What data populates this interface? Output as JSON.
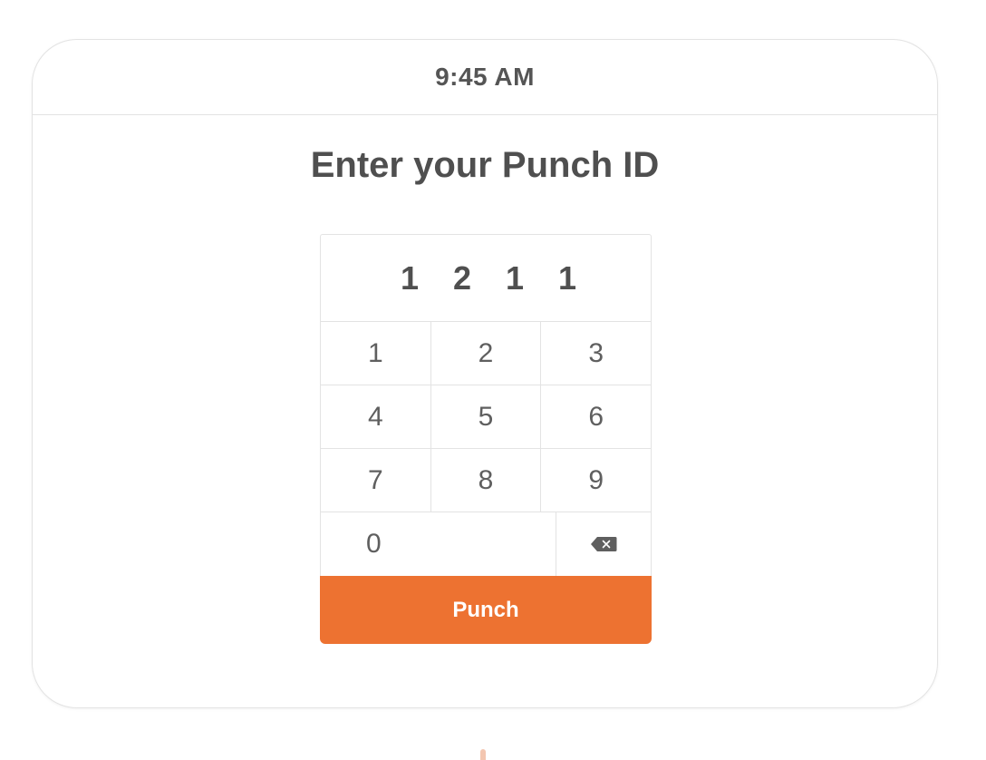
{
  "header": {
    "time": "9:45 AM"
  },
  "title": "Enter your Punch ID",
  "entered_digits": [
    "1",
    "2",
    "1",
    "1"
  ],
  "keypad": {
    "rows": [
      [
        "1",
        "2",
        "3"
      ],
      [
        "4",
        "5",
        "6"
      ],
      [
        "7",
        "8",
        "9"
      ]
    ],
    "zero": "0",
    "backspace_icon": "backspace-icon"
  },
  "punch_button": {
    "label": "Punch"
  },
  "colors": {
    "accent": "#ED7231",
    "text": "#4F4F4F",
    "border": "#E3E3E3"
  }
}
